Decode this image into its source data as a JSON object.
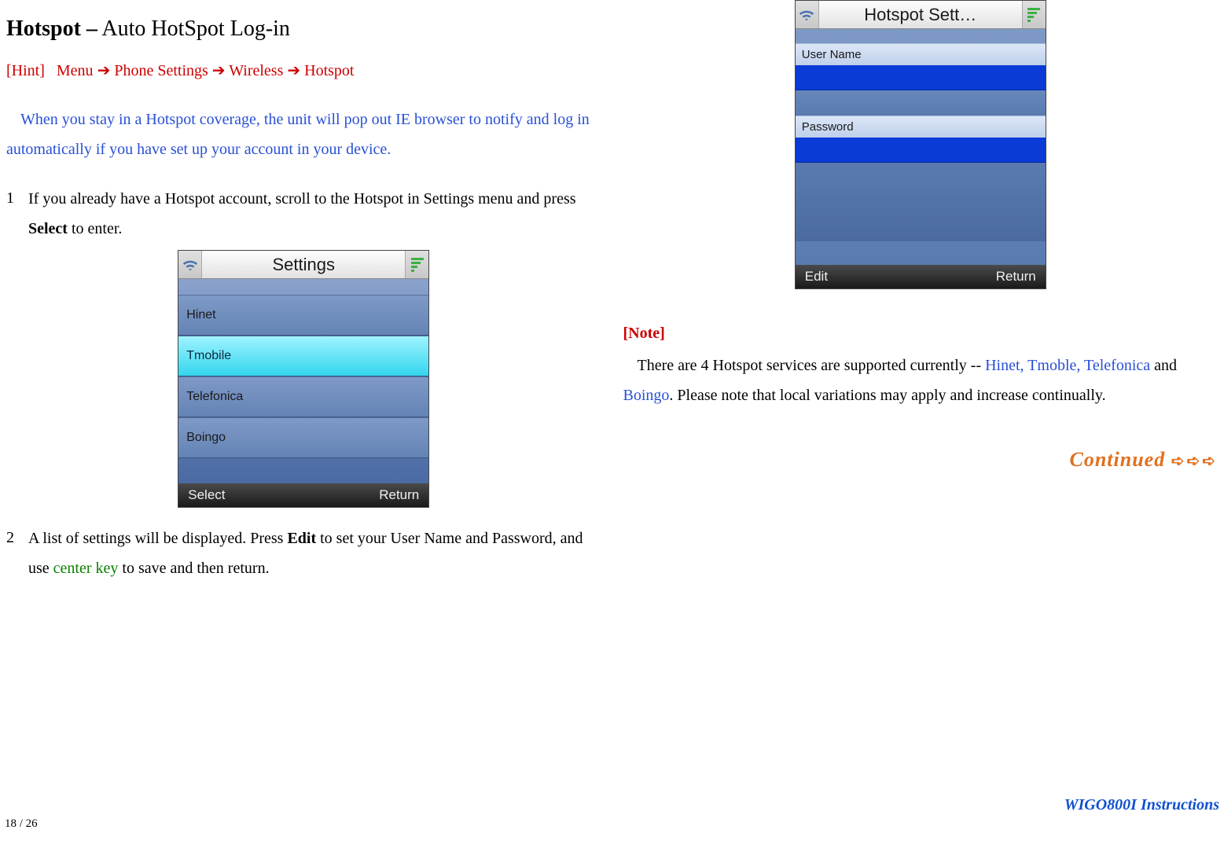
{
  "title": {
    "bold": "Hotspot –",
    "rest": " Auto HotSpot Log-in"
  },
  "hint": {
    "label": "[Hint]",
    "path": [
      "Menu",
      "Phone Settings",
      "Wireless",
      "Hotspot"
    ],
    "arrow": "➔"
  },
  "intro": "When you stay in a Hotspot coverage, the unit will pop out IE browser to notify and log in automatically if you have set up your account in your device.",
  "steps": {
    "s1": {
      "num": "1",
      "pre": "If you already have a Hotspot account, scroll to the Hotspot in Settings menu and press ",
      "bold": "Select",
      "post": " to enter."
    },
    "s2": {
      "num": "2",
      "pre": "A list of settings will be displayed. Press ",
      "bold": "Edit",
      "mid": " to set your User Name and Password, and use ",
      "green": "center key",
      "post": " to save and then return."
    }
  },
  "phone1": {
    "title": "Settings",
    "items": [
      "Hinet",
      "Tmobile",
      "Telefonica",
      "Boingo"
    ],
    "selected_index": 1,
    "soft_left": "Select",
    "soft_right": "Return"
  },
  "phone2": {
    "title": "Hotspot Sett…",
    "field1": "User Name",
    "field2": "Password",
    "soft_left": "Edit",
    "soft_right": "Return"
  },
  "note": {
    "label": "[Note]",
    "pre": "There are 4 Hotspot services are supported currently -- ",
    "svc1": "Hinet, Tmoble, Telefonica",
    "and": " and ",
    "svc2": "Boingo",
    "post": ". Please note that local variations may apply and increase continually."
  },
  "continued": {
    "text": "Continued ",
    "arrows": "➪➪➪"
  },
  "footer": {
    "right": "WIGO800I Instructions",
    "left": "18 / 26"
  }
}
